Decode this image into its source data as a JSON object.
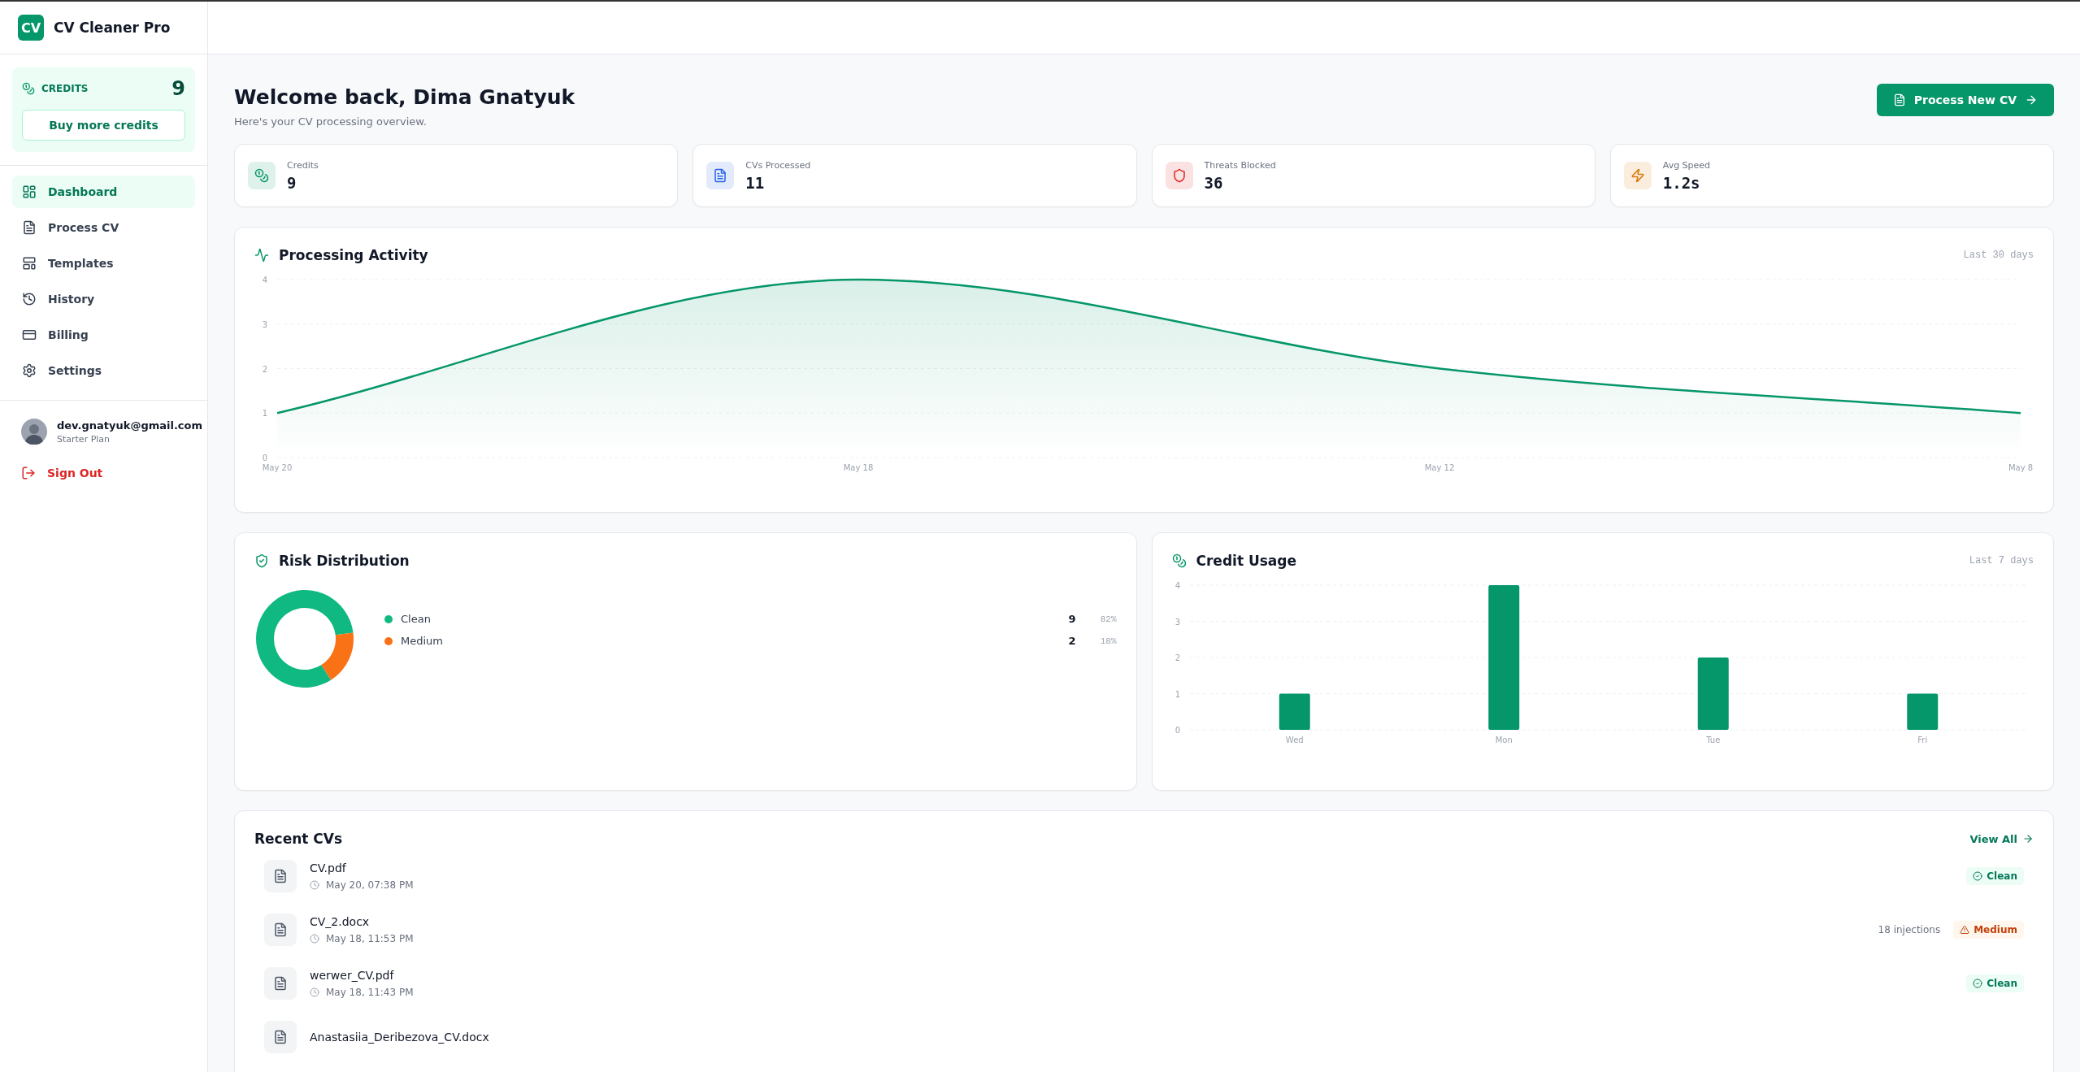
{
  "app": {
    "logo": "CV",
    "name": "CV Cleaner Pro"
  },
  "credits_box": {
    "label": "CREDITS",
    "value": "9",
    "button": "Buy more credits"
  },
  "nav": [
    {
      "label": "Dashboard",
      "selected": true
    },
    {
      "label": "Process CV",
      "selected": false
    },
    {
      "label": "Templates",
      "selected": false
    },
    {
      "label": "History",
      "selected": false
    },
    {
      "label": "Billing",
      "selected": false
    },
    {
      "label": "Settings",
      "selected": false
    }
  ],
  "user": {
    "email": "dev.gnatyuk@gmail.com",
    "plan": "Starter Plan"
  },
  "sign_out": "Sign Out",
  "header": {
    "title": "Welcome back, Dima Gnatyuk",
    "subtitle": "Here's your CV processing overview.",
    "button": "Process New CV"
  },
  "stats": [
    {
      "label": "Credits",
      "value": "9",
      "color": "#059669"
    },
    {
      "label": "CVs Processed",
      "value": "11",
      "color": "#2563eb"
    },
    {
      "label": "Threats Blocked",
      "value": "36",
      "color": "#dc2626"
    },
    {
      "label": "Avg Speed",
      "value": "1.2s",
      "color": "#d97706"
    }
  ],
  "activity": {
    "range": "Last 30 days",
    "chart_data": {
      "type": "area",
      "title": "Processing Activity",
      "categories": [
        "May 20",
        "May 18",
        "May 12",
        "May 8"
      ],
      "series": [
        {
          "color": "#059669",
          "values": [
            1,
            4,
            2,
            1
          ]
        }
      ],
      "ylim": [
        0,
        4
      ],
      "yticks": [
        0,
        1,
        2,
        3,
        4
      ],
      "grid": true
    }
  },
  "risk": {
    "chart_data": {
      "type": "donut",
      "title": "Risk Distribution",
      "categories": [
        "Clean",
        "Medium"
      ],
      "values": [
        82,
        18
      ]
    },
    "legend": [
      {
        "count": "9",
        "percent": "82%",
        "color": "#10b981"
      },
      {
        "count": "2",
        "percent": "18%",
        "color": "#f97316"
      }
    ]
  },
  "credit_usage": {
    "range": "Last 7 days",
    "chart_data": {
      "type": "bar",
      "title": "Credit Usage",
      "categories": [
        "Wed",
        "Mon",
        "Tue",
        "Fri"
      ],
      "series": [
        {
          "color": "#059669",
          "values": [
            1,
            4,
            2,
            1
          ]
        }
      ],
      "ylim": [
        0,
        4
      ],
      "yticks": [
        0,
        1,
        2,
        3,
        4
      ],
      "grid": true
    }
  },
  "recent": {
    "title": "Recent CVs",
    "link": "View All",
    "rows": [
      {
        "file": "CV.pdf",
        "time": "May 20, 07:38 PM",
        "kind": "clean",
        "badge": "Clean"
      },
      {
        "file": "CV_2.docx",
        "time": "May 18, 11:53 PM",
        "injections": "18 injections",
        "kind": "medium",
        "badge": "Medium"
      },
      {
        "file": "werwer_CV.pdf",
        "time": "May 18, 11:43 PM",
        "kind": "clean",
        "badge": "Clean"
      },
      {
        "file": "Anastasiia_Deribezova_CV.docx"
      }
    ]
  }
}
